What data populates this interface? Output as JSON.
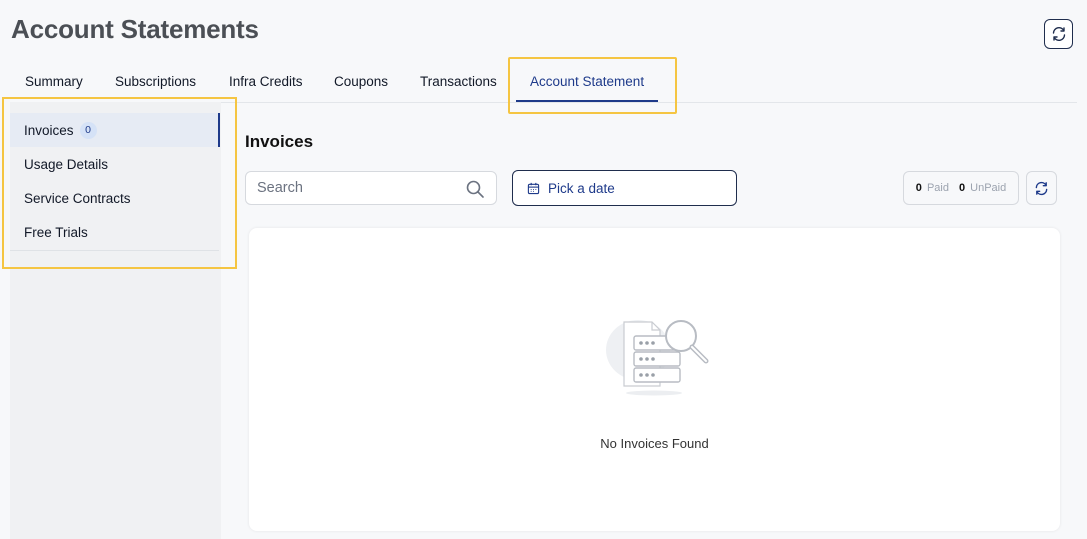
{
  "page": {
    "title": "Account Statements"
  },
  "header": {
    "refresh_icon": "refresh-icon"
  },
  "tabs": [
    {
      "label": "Summary",
      "active": false
    },
    {
      "label": "Subscriptions",
      "active": false
    },
    {
      "label": "Infra Credits",
      "active": false
    },
    {
      "label": "Coupons",
      "active": false
    },
    {
      "label": "Transactions",
      "active": false
    },
    {
      "label": "Account Statement",
      "active": true
    }
  ],
  "sidebar": {
    "items": [
      {
        "label": "Invoices",
        "badge": "0",
        "active": true
      },
      {
        "label": "Usage Details",
        "active": false
      },
      {
        "label": "Service Contracts",
        "active": false
      },
      {
        "label": "Free Trials",
        "active": false
      }
    ]
  },
  "main": {
    "title": "Invoices",
    "search": {
      "placeholder": "Search",
      "value": ""
    },
    "date_picker": {
      "label": "Pick a date",
      "icon": "calendar-icon"
    },
    "status": {
      "paid_count": "0",
      "paid_label": "Paid",
      "unpaid_count": "0",
      "unpaid_label": "UnPaid"
    },
    "empty_state": {
      "message": "No Invoices Found",
      "icon": "empty-invoices-illustration"
    }
  },
  "colors": {
    "accent": "#1e3a8a",
    "highlight": "#f5c542",
    "background": "#f7f8fa"
  }
}
